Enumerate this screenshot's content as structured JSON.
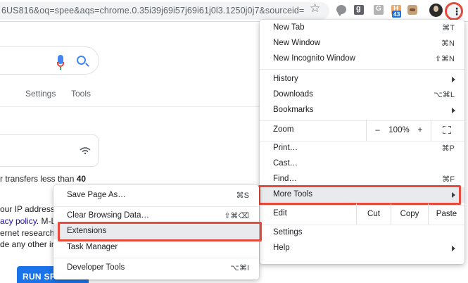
{
  "browser": {
    "url": "6US816&oq=spee&aqs=chrome.0.35i39j69i57j69i61j0l3.1250j0j7&sourceid=chro…",
    "extension_badge": "43",
    "accent_color": "#e64a3b"
  },
  "page": {
    "nav": {
      "settings": "Settings",
      "tools": "Tools"
    },
    "lines": {
      "l1_a": "r transfers less than ",
      "l1_b": "40",
      "l2": "our IP address w",
      "l3_link": "acy policy",
      "l3_rest": ". M-La",
      "l4": "ernet research. F",
      "l5": "de any other inf"
    },
    "run_button": "RUN SPEED TEST"
  },
  "menu": {
    "new_tab": {
      "label": "New Tab",
      "shortcut": "⌘T"
    },
    "new_window": {
      "label": "New Window",
      "shortcut": "⌘N"
    },
    "new_incognito": {
      "label": "New Incognito Window",
      "shortcut": "⇧⌘N"
    },
    "history": {
      "label": "History"
    },
    "downloads": {
      "label": "Downloads",
      "shortcut": "⌥⌘L"
    },
    "bookmarks": {
      "label": "Bookmarks"
    },
    "zoom": {
      "label": "Zoom",
      "minus": "–",
      "value": "100%",
      "plus": "+"
    },
    "print": {
      "label": "Print…",
      "shortcut": "⌘P"
    },
    "cast": {
      "label": "Cast…"
    },
    "find": {
      "label": "Find…",
      "shortcut": "⌘F"
    },
    "more_tools": {
      "label": "More Tools"
    },
    "edit": {
      "label": "Edit",
      "cut": "Cut",
      "copy": "Copy",
      "paste": "Paste"
    },
    "settings": {
      "label": "Settings"
    },
    "help": {
      "label": "Help"
    }
  },
  "submenu": {
    "save_page": {
      "label": "Save Page As…",
      "shortcut": "⌘S"
    },
    "clear_data": {
      "label": "Clear Browsing Data…",
      "shortcut": "⇧⌘⌫"
    },
    "extensions": {
      "label": "Extensions"
    },
    "task_manager": {
      "label": "Task Manager"
    },
    "developer_tools": {
      "label": "Developer Tools",
      "shortcut": "⌥⌘I"
    }
  }
}
